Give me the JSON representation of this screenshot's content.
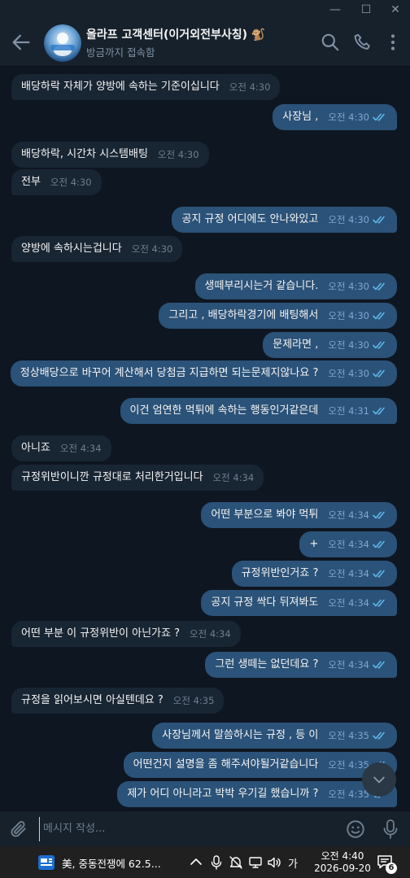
{
  "window": {
    "minimize": "—",
    "maximize": "☐",
    "close": "✕"
  },
  "header": {
    "name": "올라프 고객센터(이거외전부사칭) 🐒",
    "status": "방금까지 접속함"
  },
  "messages": [
    {
      "dir": "in",
      "text": "배당하락 자체가 양방에 속하는 기준이십니다",
      "time": "오전 4:30"
    },
    {
      "dir": "out",
      "text": "사장님 ,",
      "time": "오전 4:30"
    },
    {
      "dir": "in",
      "text": "배당하락, 시간차 시스템배팅",
      "time": "오전 4:30"
    },
    {
      "dir": "in",
      "text": "전부",
      "time": "오전 4:30"
    },
    {
      "dir": "out",
      "text": "공지 규정 어디에도 안나와있고",
      "time": "오전 4:30"
    },
    {
      "dir": "in",
      "text": "양방에 속하시는겁니다",
      "time": "오전 4:30"
    },
    {
      "dir": "out",
      "text": "생떼부리시는거 같습니다.",
      "time": "오전 4:30"
    },
    {
      "dir": "out",
      "text": "그리고 , 배당하락경기에 배팅해서",
      "time": "오전 4:30"
    },
    {
      "dir": "out",
      "text": "문제라면 ,",
      "time": "오전 4:30"
    },
    {
      "dir": "out",
      "text": "정상배당으로 바꾸어 계산해서 당첨금 지급하면 되는문제지않나요 ?",
      "time": "오전 4:30"
    },
    {
      "dir": "out",
      "text": "이건 엄연한 먹튀에 속하는 행동인거같은데",
      "time": "오전 4:31"
    },
    {
      "dir": "in",
      "text": "아니죠",
      "time": "오전 4:34"
    },
    {
      "dir": "in",
      "text": "규정위반이니깐 규정대로 처리한거입니다",
      "time": "오전 4:34"
    },
    {
      "dir": "out",
      "text": "어떤 부분으로 봐야 먹튀",
      "time": "오전 4:34"
    },
    {
      "dir": "out",
      "text": "+",
      "time": "오전 4:34"
    },
    {
      "dir": "out",
      "text": "규정위반인거죠 ?",
      "time": "오전 4:34"
    },
    {
      "dir": "out",
      "text": "공지 규정 싹다 뒤져봐도",
      "time": "오전 4:34"
    },
    {
      "dir": "in",
      "text": "어떤 부분 이 규정위반이 아닌가죠 ?",
      "time": "오전 4:34"
    },
    {
      "dir": "out",
      "text": "그런 생떼는 없던데요 ?",
      "time": "오전 4:34"
    },
    {
      "dir": "in",
      "text": "규정을 읽어보시면 아실텐데요 ?",
      "time": "오전 4:35"
    },
    {
      "dir": "out",
      "text": "사장님께서 말씀하시는 규정 , 등 이",
      "time": "오전 4:35"
    },
    {
      "dir": "out",
      "text": "어떤건지 설명을 좀 해주셔야될거같습니다",
      "time": "오전 4:35"
    },
    {
      "dir": "out",
      "text": "제가 어디 아니라고 박박 우기길 했습니까 ?",
      "time": "오전 4:35"
    }
  ],
  "composer": {
    "placeholder": "메시지 작성..."
  },
  "taskbar": {
    "news": "美, 중동전쟁에 62.5...",
    "ime": "가",
    "time": "오전 4:40",
    "date": "2026-09-20",
    "notification_count": "6"
  },
  "colors": {
    "chat_bg": "#0e1621",
    "header_bg": "#17212b",
    "incoming_bubble": "#182533",
    "outgoing_bubble": "#2b5278",
    "read_check": "#5fb7e8"
  },
  "icons": {
    "back": "arrow-left-icon",
    "search": "search-icon",
    "call": "phone-icon",
    "menu": "more-vertical-icon",
    "attach": "paperclip-icon",
    "emoji": "smile-icon",
    "mic": "microphone-icon",
    "scroll": "chevron-down-icon"
  }
}
